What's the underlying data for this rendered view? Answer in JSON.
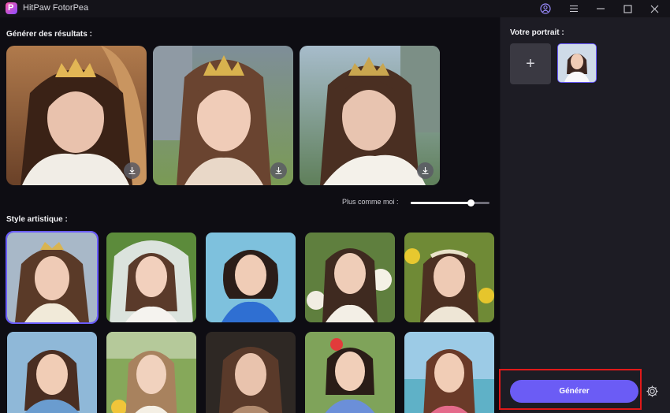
{
  "app": {
    "title": "HitPaw FotorPea",
    "logo_letter": "P"
  },
  "window_controls": [
    "account-icon",
    "menu-icon",
    "minimize-icon",
    "maximize-icon",
    "close-icon"
  ],
  "main": {
    "results_label": "Générer des résultats :",
    "results": [
      {
        "name": "result-1",
        "download_icon": "download-icon"
      },
      {
        "name": "result-2",
        "download_icon": "download-icon"
      },
      {
        "name": "result-3",
        "download_icon": "download-icon"
      }
    ],
    "style_label": "Style artistique :",
    "slider": {
      "label": "Plus comme moi :",
      "value": 0.76
    },
    "styles": [
      {
        "name": "style-princess",
        "selected": true
      },
      {
        "name": "style-bride-veil"
      },
      {
        "name": "style-blue-dress"
      },
      {
        "name": "style-white-flowers"
      },
      {
        "name": "style-flower-crown"
      },
      {
        "name": "style-business"
      },
      {
        "name": "style-garden"
      },
      {
        "name": "style-studio"
      },
      {
        "name": "style-kimono"
      },
      {
        "name": "style-beach"
      }
    ]
  },
  "side": {
    "portrait_label": "Votre portrait :",
    "add_symbol": "+",
    "generate_label": "Générer"
  },
  "colors": {
    "accent": "#6b5cf5",
    "highlight": "#e01919",
    "panel": "#1d1c24",
    "main_bg": "#0e0d13"
  }
}
